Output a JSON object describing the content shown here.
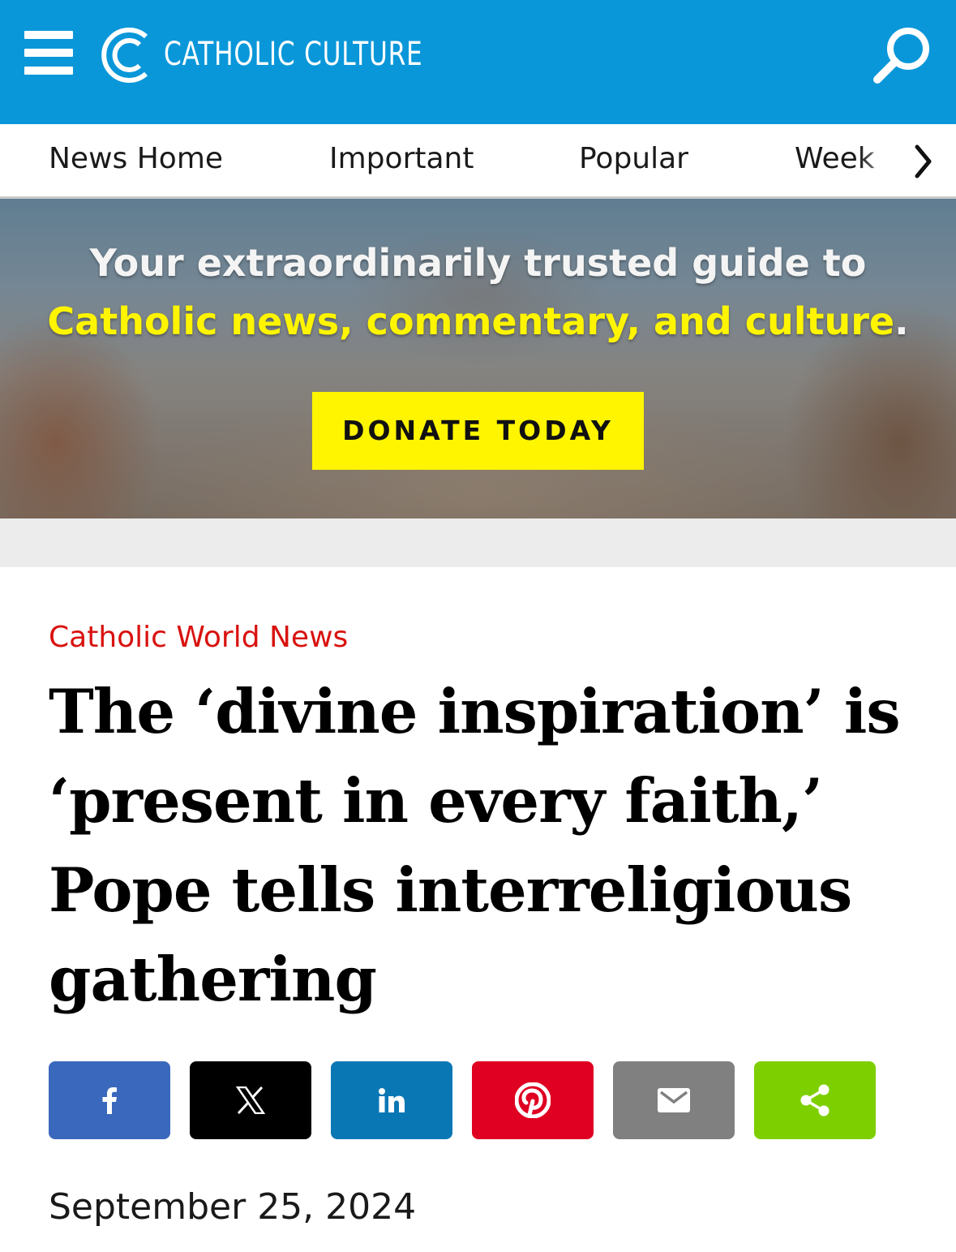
{
  "header": {
    "logo_text": "CATHOLIC CULTURE",
    "menu_icon": "hamburger-menu-icon",
    "logo_icon": "catholic-culture-c-logo",
    "search_icon": "magnifier-search-icon",
    "background_color": "#0a97d9"
  },
  "tabs": {
    "items": [
      {
        "label": "News Home"
      },
      {
        "label": "Important"
      },
      {
        "label": "Popular"
      },
      {
        "label": "Week"
      }
    ],
    "next_icon": "chevron-right-icon"
  },
  "hero": {
    "line1": "Your extraordinarily trusted guide to",
    "line2_highlight": "Catholic news, commentary, and culture",
    "line2_end": ".",
    "highlight_color": "#fff500",
    "donate_label": "DONATE TODAY"
  },
  "article": {
    "category": "Catholic World News",
    "category_color": "#d8120f",
    "headline": "The ‘divine inspiration’ is ‘present in every faith,’ Pope tells interreligious gathering",
    "date": "September 25, 2024"
  },
  "share": {
    "buttons": [
      {
        "name": "facebook",
        "icon": "facebook-icon",
        "color": "#3a68bd"
      },
      {
        "name": "x",
        "icon": "x-twitter-icon",
        "color": "#000000"
      },
      {
        "name": "linkedin",
        "icon": "linkedin-icon",
        "color": "#0a77b5"
      },
      {
        "name": "pinterest",
        "icon": "pinterest-icon",
        "color": "#df0022"
      },
      {
        "name": "email",
        "icon": "email-icon",
        "color": "#808080"
      },
      {
        "name": "share",
        "icon": "share-icon",
        "color": "#7ecf00"
      }
    ]
  }
}
